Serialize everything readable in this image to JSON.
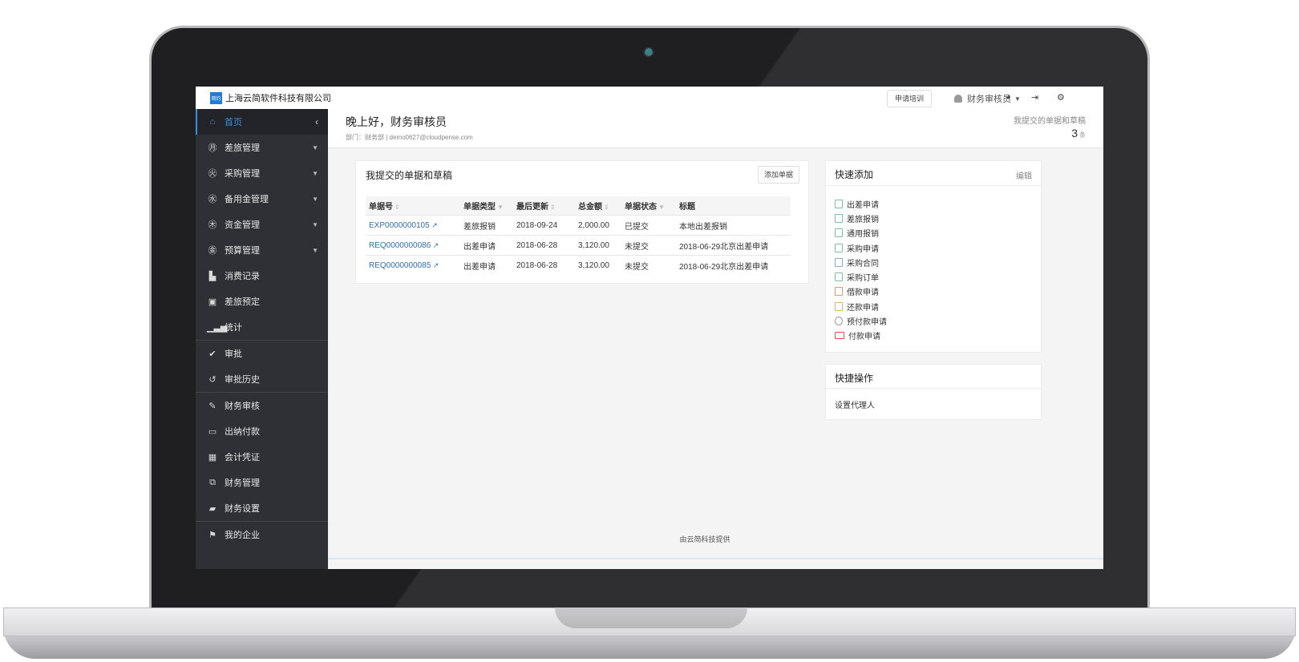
{
  "topbar": {
    "company": "上海云简软件科技有限公司",
    "logo_text": "简约",
    "apply_training": "申请培训",
    "user_name": "财务审核员"
  },
  "sidebar": {
    "items": [
      {
        "label": "首页",
        "icon": "home-icon"
      },
      {
        "label": "差旅管理",
        "icon": "travel-icon"
      },
      {
        "label": "采购管理",
        "icon": "purchase-icon"
      },
      {
        "label": "备用金管理",
        "icon": "reserve-icon"
      },
      {
        "label": "资金管理",
        "icon": "fund-icon"
      },
      {
        "label": "预算管理",
        "icon": "budget-icon"
      },
      {
        "label": "消费记录",
        "icon": "record-icon"
      },
      {
        "label": "差旅预定",
        "icon": "suitcase-icon"
      },
      {
        "label": "统计",
        "icon": "chart-icon"
      },
      {
        "label": "审批",
        "icon": "check-circle-icon"
      },
      {
        "label": "审批历史",
        "icon": "history-icon"
      },
      {
        "label": "财务审核",
        "icon": "edit-icon"
      },
      {
        "label": "出纳付款",
        "icon": "cash-icon"
      },
      {
        "label": "会计凭证",
        "icon": "calculator-icon"
      },
      {
        "label": "财务管理",
        "icon": "manage-icon"
      },
      {
        "label": "财务设置",
        "icon": "settings-icon"
      },
      {
        "label": "我的企业",
        "icon": "flag-icon"
      }
    ]
  },
  "header": {
    "greeting": "晚上好，财务审核员",
    "dept": "部门：财务部 | demo0627@cloudpense.com",
    "stat_label": "我提交的单据和草稿",
    "stat_count": "3",
    "stat_unit": "条"
  },
  "docs": {
    "title": "我提交的单据和草稿",
    "add_button": "添加单据",
    "columns": [
      "单据号",
      "单据类型",
      "最后更新",
      "总金额",
      "单据状态",
      "标题"
    ],
    "rows": [
      {
        "id": "EXP0000000105",
        "type": "差旅报销",
        "updated": "2018-09-24",
        "amount": "2,000.00",
        "status": "已提交",
        "title": "本地出差报销"
      },
      {
        "id": "REQ0000000086",
        "type": "出差申请",
        "updated": "2018-06-28",
        "amount": "3,120.00",
        "status": "未提交",
        "title": "2018-06-29北京出差申请"
      },
      {
        "id": "REQ0000000085",
        "type": "出差申请",
        "updated": "2018-06-28",
        "amount": "3,120.00",
        "status": "未提交",
        "title": "2018-06-29北京出差申请"
      }
    ]
  },
  "quick_add": {
    "title": "快速添加",
    "edit": "编辑",
    "items": [
      "出差申请",
      "差旅报销",
      "通用报销",
      "采购申请",
      "采购合同",
      "采购订单",
      "借款申请",
      "还款申请",
      "预付款申请",
      "付款申请"
    ]
  },
  "quick_ops": {
    "title": "快捷操作",
    "item": "设置代理人"
  },
  "footer": {
    "text": "由云简科技提供"
  }
}
